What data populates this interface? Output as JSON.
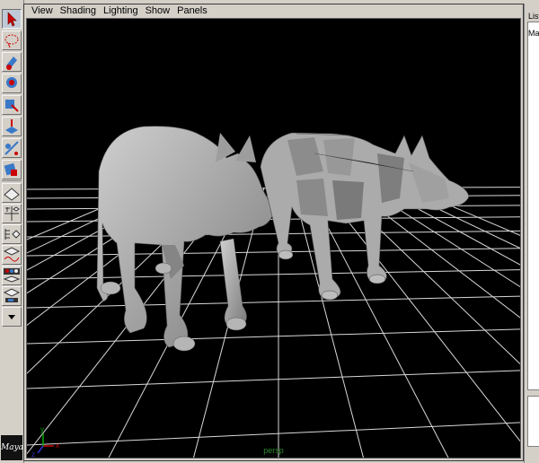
{
  "menu": [
    "View",
    "Shading",
    "Lighting",
    "Show",
    "Panels"
  ],
  "viewport": {
    "camera_label": "persp"
  },
  "axis": {
    "x": "x",
    "y": "y",
    "z": "z"
  },
  "side_panel": {
    "tab_label": "List",
    "row_label": "Ma"
  },
  "logo_text": "Maya",
  "colors": {
    "viewport_bg": "#000000",
    "grid": "#d8d8d8",
    "model_smooth": "#bdbdbd",
    "model_faceted": "#a9a9a9"
  }
}
